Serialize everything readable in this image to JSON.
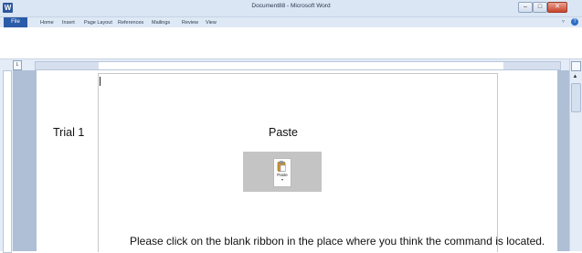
{
  "window": {
    "title": "Document88 - Microsoft Word",
    "app_icon": "W",
    "minimize_label": "–",
    "maximize_label": "□",
    "close_label": "✕"
  },
  "menu": {
    "file": "File",
    "items": [
      "Home",
      "Insert",
      "Page Layout",
      "References",
      "Mailings",
      "Review",
      "View"
    ],
    "minimize_ribbon": "▿",
    "help": "?"
  },
  "ruler": {
    "tab_selector": "L"
  },
  "document": {
    "trial_label": "Trial 1",
    "paste_title": "Paste",
    "paste_button_label": "Paste",
    "paste_button_arrow": "▾",
    "instruction": "Please click on the blank ribbon in the place where you think the command is located."
  },
  "colors": {
    "accent": "#2a5ba8",
    "document_background": "#aebfd6",
    "paste_box": "#c4c4c4"
  },
  "icons": [
    "word-app-icon",
    "help-icon",
    "clipboard-paste-icon",
    "scroll-up-arrow-icon"
  ]
}
